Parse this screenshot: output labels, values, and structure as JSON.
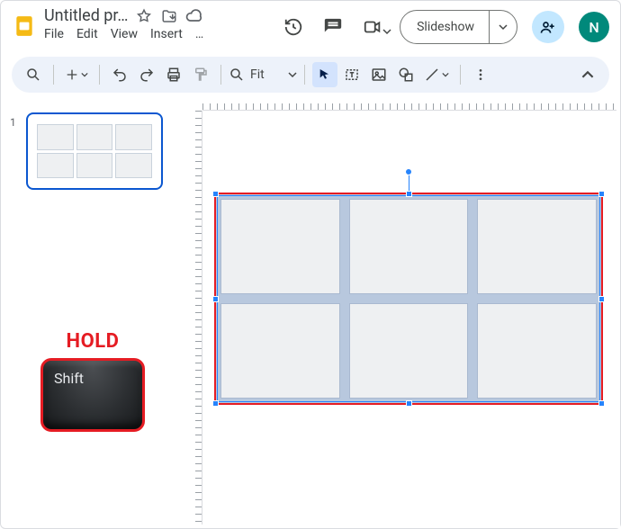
{
  "header": {
    "doc_title": "Untitled pr…",
    "menus": {
      "file": "File",
      "edit": "Edit",
      "view": "View",
      "insert": "Insert",
      "more": "…"
    },
    "slideshow_label": "Slideshow",
    "avatar_initial": "N"
  },
  "toolbar": {
    "zoom_label": "Fit"
  },
  "filmstrip": {
    "slides": [
      {
        "number": "1"
      }
    ]
  },
  "annotation": {
    "hold_label": "HOLD",
    "key_label": "Shift"
  },
  "canvas": {
    "selected_object": "table-3x2",
    "selection_color": "#e51c23"
  }
}
